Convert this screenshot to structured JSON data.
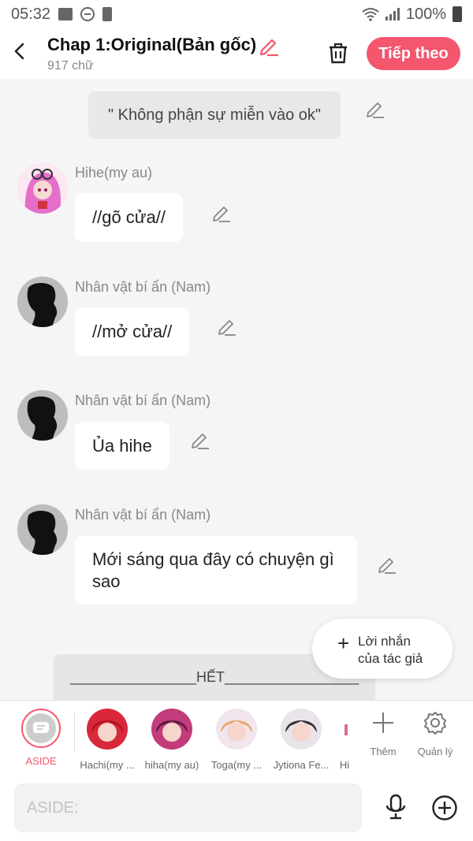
{
  "status": {
    "time": "05:32",
    "battery": "100%"
  },
  "header": {
    "title": "Chap 1:Original(Bản gốc)",
    "word_count": "917 chữ",
    "next_label": "Tiếp theo"
  },
  "narration": " \" Không phận sự miễn vào ok\"",
  "messages": [
    {
      "name": "Hihe(my au)",
      "text": "//gõ cửa//",
      "avatar": "pink-hair-character"
    },
    {
      "name": "Nhân vật bí ẩn (Nam)",
      "text": "//mở cửa//",
      "avatar": "silhouette"
    },
    {
      "name": "Nhân vật bí ẩn (Nam)",
      "text": "Ủa hihe",
      "avatar": "silhouette"
    },
    {
      "name": "Nhân vật bí ẩn (Nam)",
      "text": "Mới sáng qua đây có chuyện gì sao",
      "avatar": "silhouette"
    }
  ],
  "note_button": {
    "line1": "Lời nhắn",
    "line2": "của tác giả"
  },
  "ending": "________________HẾT_________________",
  "characters": {
    "aside_label": "ASIDE",
    "items": [
      {
        "label": "Hachi(my ...",
        "color": "#d8283a"
      },
      {
        "label": "hiha(my au)",
        "color": "#c23b7a"
      },
      {
        "label": "Toga(my ...",
        "color": "#e9a76a"
      },
      {
        "label": "Jytiona Fe...",
        "color": "#3a2b3a"
      },
      {
        "label": "Hi",
        "color": "#e06b8f"
      }
    ],
    "add_label": "Thêm",
    "manage_label": "Quản lý"
  },
  "input": {
    "placeholder": "ASIDE:"
  },
  "colors": {
    "accent": "#f4566e",
    "background": "#f5f5f5"
  }
}
